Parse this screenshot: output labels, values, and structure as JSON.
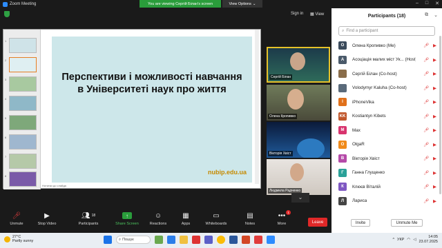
{
  "app": {
    "title": "Zoom Meeting"
  },
  "banner": {
    "viewing_text": "You are viewing Сергій Білан's screen",
    "view_options": "View Options"
  },
  "topbar": {
    "sign_in": "Sign in",
    "view": "View"
  },
  "slide": {
    "title": "Перспективи і можливості навчання в Університеті наук про життя",
    "url": "nubip.edu.ua",
    "notes": "Нотатки до слайда"
  },
  "gallery": [
    {
      "name": "Сергій Білан",
      "active": true
    },
    {
      "name": "Олена Кропивко",
      "active": false
    },
    {
      "name": "Вікторія Хвіст",
      "active": false
    },
    {
      "name": "Людмила Радченко",
      "active": false
    }
  ],
  "toolbar": {
    "unmute": "Unmute",
    "stop_video": "Stop Video",
    "participants": "Participants",
    "participants_count": "18",
    "share_screen": "Share Screen",
    "reactions": "Reactions",
    "apps": "Apps",
    "whiteboards": "Whiteboards",
    "notes": "Notes",
    "more": "More",
    "more_badge": "1",
    "leave": "Leave"
  },
  "panel": {
    "title": "Participants (18)",
    "search_placeholder": "Find a participant",
    "participants": [
      {
        "initial": "O",
        "color": "#3b4b5c",
        "name": "Олена Кропивко (Me)"
      },
      {
        "initial": "A",
        "color": "#4a5a6a",
        "name": "Асоціація малих міст Ук... (Host)"
      },
      {
        "initial": "",
        "color": "#8a6d4a",
        "name": "Сергій Білан (Co-host)"
      },
      {
        "initial": "",
        "color": "#5a6a7a",
        "name": "Volodymyr Kaluha (Co-host)"
      },
      {
        "initial": "I",
        "color": "#e0701a",
        "name": "iPhoneVika"
      },
      {
        "initial": "KK",
        "color": "#c0562b",
        "name": "Kostiantyn Kibets"
      },
      {
        "initial": "M",
        "color": "#d8346e",
        "name": "Max"
      },
      {
        "initial": "O",
        "color": "#f08a1a",
        "name": "OlgaR"
      },
      {
        "initial": "В",
        "color": "#b54aa8",
        "name": "Вікторія Хвіст"
      },
      {
        "initial": "Г",
        "color": "#2aa198",
        "name": "Ганна Глущенко"
      },
      {
        "initial": "К",
        "color": "#7e57c2",
        "name": "Клюєв Віталій"
      },
      {
        "initial": "Л",
        "color": "#444444",
        "name": "Лариса"
      }
    ],
    "invite": "Invite",
    "unmute_me": "Unmute Me"
  },
  "taskbar": {
    "temperature": "27°C",
    "weather": "Partly sunny",
    "search": "Пошук",
    "language": "УКР",
    "time": "14:05",
    "date": "23.07.2025"
  }
}
